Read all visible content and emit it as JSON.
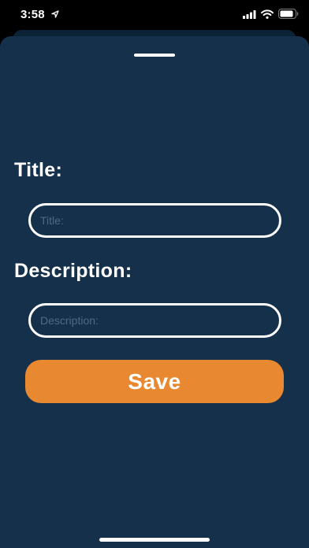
{
  "status_bar": {
    "time": "3:58",
    "icons": [
      "location-arrow-icon",
      "signal-icon",
      "wifi-icon",
      "battery-icon"
    ]
  },
  "form": {
    "title_label": "Title:",
    "title_placeholder": "Title:",
    "title_value": "",
    "description_label": "Description:",
    "description_placeholder": "Description:",
    "description_value": "",
    "save_label": "Save"
  },
  "colors": {
    "background": "#14304a",
    "accent": "#e88830",
    "text": "#ffffff",
    "placeholder": "#4d6b86"
  }
}
